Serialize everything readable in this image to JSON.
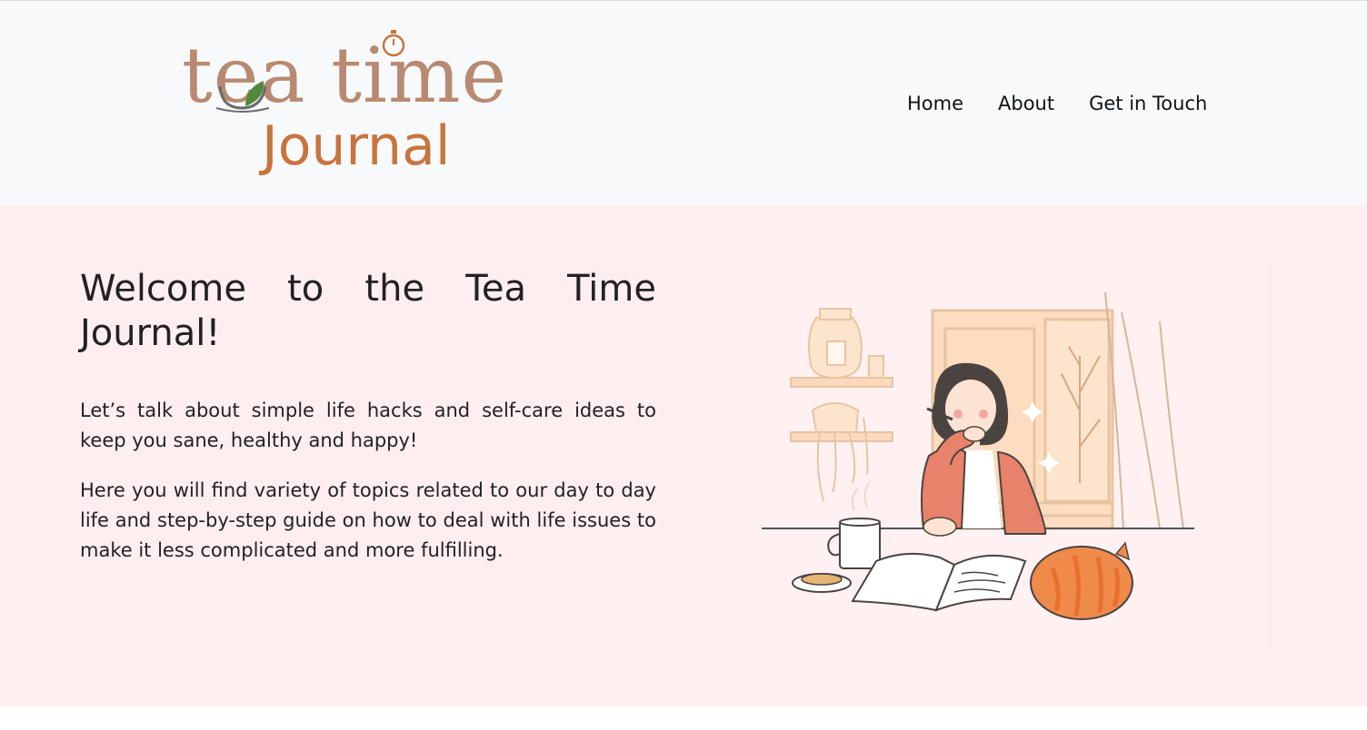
{
  "header": {
    "logo": {
      "line1": "tea time",
      "line2": "Journal"
    },
    "nav": [
      {
        "label": "Home"
      },
      {
        "label": "About"
      },
      {
        "label": "Get in Touch"
      }
    ]
  },
  "hero": {
    "title": "Welcome to the Tea Time Journal!",
    "paragraphs": [
      "Let’s talk about simple life hacks and self-care ideas to keep you sane, healthy and happy!",
      "Here you will find variety of topics related to our day to day life and step-by-step guide on how to deal with life issues to make it less complicated and more fulfilling."
    ],
    "illustration": "woman-journaling-illustration"
  },
  "colors": {
    "header_bg": "#f8f9fa",
    "hero_bg": "#ffeef0",
    "logo_brown": "#b88a72",
    "logo_orange": "#c8743e",
    "sweater": "#e8826a",
    "cat": "#f08a4b"
  }
}
